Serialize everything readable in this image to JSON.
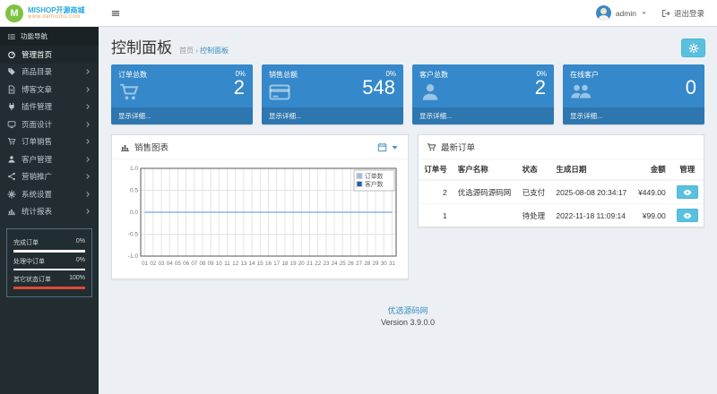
{
  "logo": {
    "title": "MISHOP开源商城",
    "subtitle": "www.damicms.com"
  },
  "topbar": {
    "username": "admin",
    "logout_label": "退出登录"
  },
  "sidebar": {
    "nav_header": "功能导航",
    "items": [
      {
        "label": "管理首页",
        "icon": "dashboard-icon",
        "active": true,
        "has_children": false
      },
      {
        "label": "商品目录",
        "icon": "tags-icon",
        "active": false,
        "has_children": true
      },
      {
        "label": "博客文章",
        "icon": "file-icon",
        "active": false,
        "has_children": true
      },
      {
        "label": "插件管理",
        "icon": "plug-icon",
        "active": false,
        "has_children": true
      },
      {
        "label": "页面设计",
        "icon": "monitor-icon",
        "active": false,
        "has_children": true
      },
      {
        "label": "订单销售",
        "icon": "cart-icon",
        "active": false,
        "has_children": true
      },
      {
        "label": "客户管理",
        "icon": "user-icon",
        "active": false,
        "has_children": true
      },
      {
        "label": "营销推广",
        "icon": "share-icon",
        "active": false,
        "has_children": true
      },
      {
        "label": "系统设置",
        "icon": "gear-icon",
        "active": false,
        "has_children": true
      },
      {
        "label": "统计报表",
        "icon": "bar-chart-icon",
        "active": false,
        "has_children": true
      }
    ],
    "progress": [
      {
        "label": "完成订单",
        "value": "0%",
        "pct": 0,
        "color": "#ffffff"
      },
      {
        "label": "处理中订单",
        "value": "0%",
        "pct": 0,
        "color": "#ffffff"
      },
      {
        "label": "其它状态订单",
        "value": "100%",
        "pct": 100,
        "color": "#dd4b39"
      }
    ]
  },
  "page": {
    "title": "控制面板",
    "breadcrumb_home": "首页",
    "breadcrumb_sep": "›",
    "breadcrumb_current": "控制面板"
  },
  "stat_footer_label": "显示详细...",
  "stats": [
    {
      "label": "订单总数",
      "pct": "0%",
      "value": "2",
      "icon": "cart-icon"
    },
    {
      "label": "销售总额",
      "pct": "0%",
      "value": "548",
      "icon": "credit-card-icon"
    },
    {
      "label": "客户总数",
      "pct": "0%",
      "value": "2",
      "icon": "user-icon"
    },
    {
      "label": "在线客户",
      "pct": "",
      "value": "0",
      "icon": "users-icon"
    }
  ],
  "chart_panel": {
    "title": "销售图表"
  },
  "chart_data": {
    "type": "line",
    "title": "销售图表",
    "x_labels": [
      "01",
      "02",
      "03",
      "04",
      "05",
      "06",
      "07",
      "08",
      "09",
      "10",
      "11",
      "12",
      "13",
      "14",
      "15",
      "16",
      "17",
      "18",
      "19",
      "20",
      "21",
      "22",
      "23",
      "24",
      "25",
      "26",
      "27",
      "28",
      "29",
      "30",
      "31"
    ],
    "series": [
      {
        "name": "订单数",
        "color": "#9abfe8",
        "values": [
          0,
          0,
          0,
          0,
          0,
          0,
          0,
          0,
          0,
          0,
          0,
          0,
          0,
          0,
          0,
          0,
          0,
          0,
          0,
          0,
          0,
          0,
          0,
          0,
          0,
          0,
          0,
          0,
          0,
          0,
          0
        ]
      },
      {
        "name": "客户数",
        "color": "#1a5fb0",
        "values": [
          0,
          0,
          0,
          0,
          0,
          0,
          0,
          0,
          0,
          0,
          0,
          0,
          0,
          0,
          0,
          0,
          0,
          0,
          0,
          0,
          0,
          0,
          0,
          0,
          0,
          0,
          0,
          0,
          0,
          0,
          0
        ]
      }
    ],
    "ylim": [
      -1,
      1
    ],
    "yticks": [
      1.0,
      0.5,
      0.0,
      -0.5,
      -1.0
    ],
    "grid": true,
    "legend_position": "top-right"
  },
  "orders_panel": {
    "title": "最新订单",
    "columns": [
      "订单号",
      "客户名称",
      "状态",
      "生成日期",
      "金额",
      "管理"
    ],
    "rows": [
      {
        "order_no": "2",
        "customer": "优选源码源码网",
        "status": "已支付",
        "date": "2025-08-08 20:34:17",
        "amount": "¥449.00"
      },
      {
        "order_no": "1",
        "customer": "",
        "status": "待处理",
        "date": "2022-11-18 11:09:14",
        "amount": "¥99.00"
      }
    ]
  },
  "footer": {
    "link": "优选源码网",
    "version": "Version 3.9.0.0"
  },
  "colors": {
    "accent": "#3c8dbc",
    "card_blue": "#3588c9",
    "teal_button": "#5bc0de",
    "danger": "#dd4b39",
    "sidebar_bg": "#222d32",
    "logo_green": "#7dc243"
  }
}
